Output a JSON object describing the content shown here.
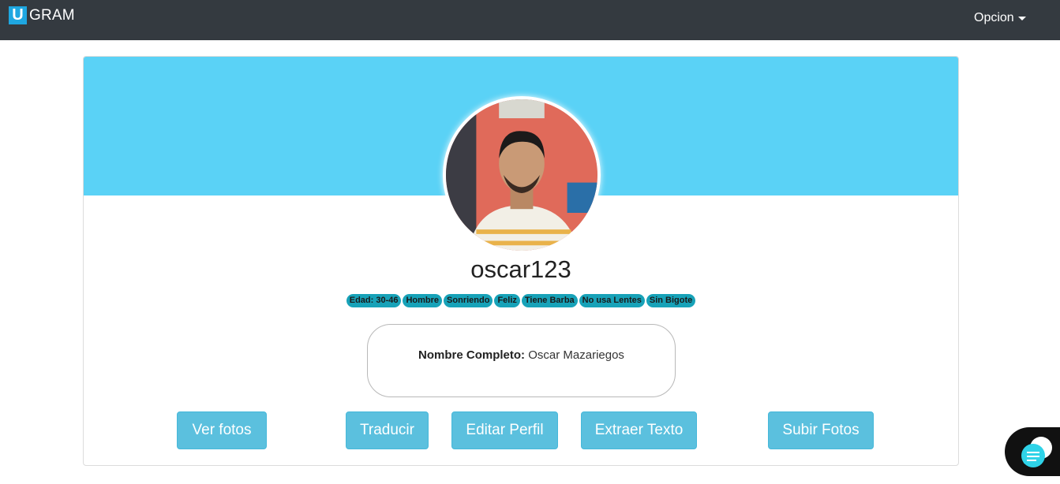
{
  "navbar": {
    "brand_letter": "U",
    "brand_text": "GRAM",
    "menu_label": "Opcion"
  },
  "profile": {
    "username": "oscar123",
    "tags": [
      "Edad: 30-46",
      "Hombre",
      "Sonriendo",
      "Feliz",
      "Tiene Barba",
      "No usa Lentes",
      "Sin Bigote"
    ],
    "full_name_label": "Nombre Completo:",
    "full_name_value": "Oscar Mazariegos"
  },
  "actions": {
    "ver_fotos": "Ver fotos",
    "traducir": "Traducir",
    "editar_perfil": "Editar Perfil",
    "extraer_texto": "Extraer Texto",
    "subir_fotos": "Subir Fotos"
  },
  "colors": {
    "navbar_bg": "#343a40",
    "banner": "#5ad2f6",
    "tag_bg": "#17a2b8",
    "button_bg": "#5bc0de"
  },
  "icons": {
    "chat": "chat-bubble-icon",
    "caret": "caret-down-icon"
  }
}
